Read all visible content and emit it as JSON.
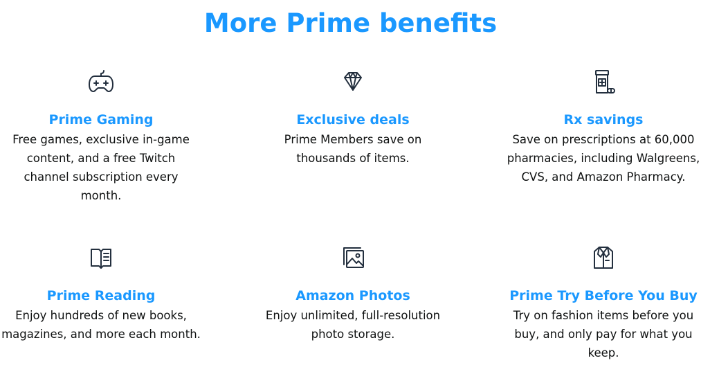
{
  "page": {
    "title": "More Prime benefits"
  },
  "colors": {
    "accent": "#1a98ff",
    "text": "#0f1111",
    "icon": "#232f3e"
  },
  "benefits": [
    {
      "icon": "game-controller-icon",
      "title": "Prime Gaming",
      "description": "Free games, exclusive in-game content, and a free Twitch channel subscription every month."
    },
    {
      "icon": "diamond-icon",
      "title": "Exclusive deals",
      "description": "Prime Members save on thousands of items."
    },
    {
      "icon": "prescription-bottle-icon",
      "title": "Rx savings",
      "description": "Save on prescriptions at 60,000 pharmacies, including Walgreens, CVS, and Amazon Pharmacy."
    },
    {
      "icon": "open-book-icon",
      "title": "Prime Reading",
      "description": "Enjoy hundreds of new books, magazines, and more each month."
    },
    {
      "icon": "photos-icon",
      "title": "Amazon Photos",
      "description": "Enjoy unlimited, full-resolution photo storage."
    },
    {
      "icon": "shirt-icon",
      "title": "Prime Try Before You Buy",
      "description": "Try on fashion items before you buy, and only pay for what you keep."
    }
  ]
}
